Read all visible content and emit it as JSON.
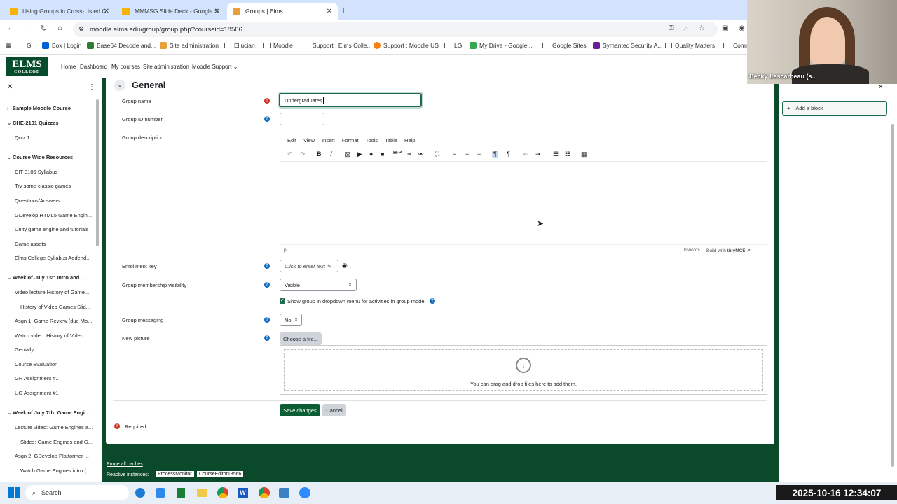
{
  "browser": {
    "tabs": [
      {
        "title": "Using Groups in Cross-Listed C",
        "color": "#f4b400"
      },
      {
        "title": "MMMSG Slide Deck - Google S",
        "color": "#f4b400"
      },
      {
        "title": "Groups | Elms",
        "color": "#e8a13a"
      }
    ],
    "url": "moodle.elms.edu/group/group.php?courseid=18566",
    "bookmarks": [
      "Box | Login",
      "Base64 Decode and...",
      "Site administration",
      "Ellucian",
      "Moodle",
      "Support : Elms Colle...",
      "Support : Moodle US",
      "LG",
      "My Drive - Google...",
      "Google Sites",
      "Symantec Security A...",
      "Quality Matters",
      "Comm"
    ]
  },
  "moodle_nav": {
    "logo_text": "ELMS",
    "logo_sub": "COLLEGE",
    "links": [
      "Home",
      "Dashboard",
      "My courses",
      "Site administration",
      "Moodle Support"
    ]
  },
  "course_index": {
    "items": [
      {
        "label": "Sample Moodle Course",
        "type": "section",
        "indent": 0
      },
      {
        "label": "CHE-2101 Quizzes",
        "type": "section",
        "indent": 0
      },
      {
        "label": "Quiz 1",
        "type": "item",
        "indent": 1
      },
      {
        "label": "Course Wide Resources",
        "type": "section",
        "indent": 0
      },
      {
        "label": "CIT 3105 Syllabus",
        "type": "item",
        "indent": 1
      },
      {
        "label": "Try some classic games",
        "type": "item",
        "indent": 1
      },
      {
        "label": "Questions/Answers",
        "type": "item",
        "indent": 1
      },
      {
        "label": "GDevelop HTML5 Game Engin...",
        "type": "item",
        "indent": 1
      },
      {
        "label": "Unity game engine and tutorials",
        "type": "item",
        "indent": 1
      },
      {
        "label": "Game assets",
        "type": "item",
        "indent": 1
      },
      {
        "label": "Elms College Syllabus Addend...",
        "type": "item",
        "indent": 1
      },
      {
        "label": "Week of July 1st: Intro and ...",
        "type": "section",
        "indent": 0
      },
      {
        "label": "Video lecture History of Game...",
        "type": "item",
        "indent": 1
      },
      {
        "label": "History of Video Games Slid...",
        "type": "item",
        "indent": 2
      },
      {
        "label": "Asgn 1: Game Review (due Mo...",
        "type": "item",
        "indent": 1
      },
      {
        "label": "Watch video: History of Video ...",
        "type": "item",
        "indent": 1
      },
      {
        "label": "Genially",
        "type": "item",
        "indent": 1
      },
      {
        "label": "Course Evaluation",
        "type": "item",
        "indent": 1
      },
      {
        "label": "GR Assignment #1",
        "type": "item",
        "indent": 1
      },
      {
        "label": "UG Assignment #1",
        "type": "item",
        "indent": 1
      },
      {
        "label": "Week of July 7th: Game Engi...",
        "type": "section",
        "indent": 0
      },
      {
        "label": "Lecture video: Game Engines a...",
        "type": "item",
        "indent": 1
      },
      {
        "label": "Slides: Game Engines and G...",
        "type": "item",
        "indent": 2
      },
      {
        "label": "Asgn 2: GDevelop Platformer ...",
        "type": "item",
        "indent": 1
      },
      {
        "label": "Watch Game Engines intro (...",
        "type": "item",
        "indent": 2
      }
    ]
  },
  "form": {
    "section_title": "General",
    "group_name_label": "Group name",
    "group_name_value": "Undergraduates",
    "group_id_label": "Group ID number",
    "group_id_value": "",
    "group_desc_label": "Group description",
    "editor_menu": [
      "Edit",
      "View",
      "Insert",
      "Format",
      "Tools",
      "Table",
      "Help"
    ],
    "editor_path": "p",
    "editor_wordcount": "0 words",
    "editor_brand": "Build with",
    "editor_brand_name": "tinyMCE",
    "enrollment_key_label": "Enrollment key",
    "enrollment_key_placeholder": "Click to enter text",
    "visibility_label": "Group membership visibility",
    "visibility_value": "Visible",
    "show_group_checkbox_label": "Show group in dropdown menu for activities in group mode",
    "show_group_checked": true,
    "messaging_label": "Group messaging",
    "messaging_value": "No",
    "new_picture_label": "New picture",
    "choose_file_label": "Choose a file...",
    "dropzone_text": "You can drag and drop files here to add them.",
    "save_label": "Save changes",
    "cancel_label": "Cancel",
    "required_label": "Required"
  },
  "footer": {
    "purge_label": "Purge all caches",
    "reactive_label": "Reactive instances:",
    "instances": [
      "ProcessMonitor",
      "CourseEditor18566"
    ]
  },
  "right_drawer": {
    "add_block_label": "Add a block"
  },
  "video": {
    "name": "Becky Lescarbeau (s..."
  },
  "taskbar": {
    "search_placeholder": "Search",
    "clock": "2025-10-16  12:34:07"
  }
}
